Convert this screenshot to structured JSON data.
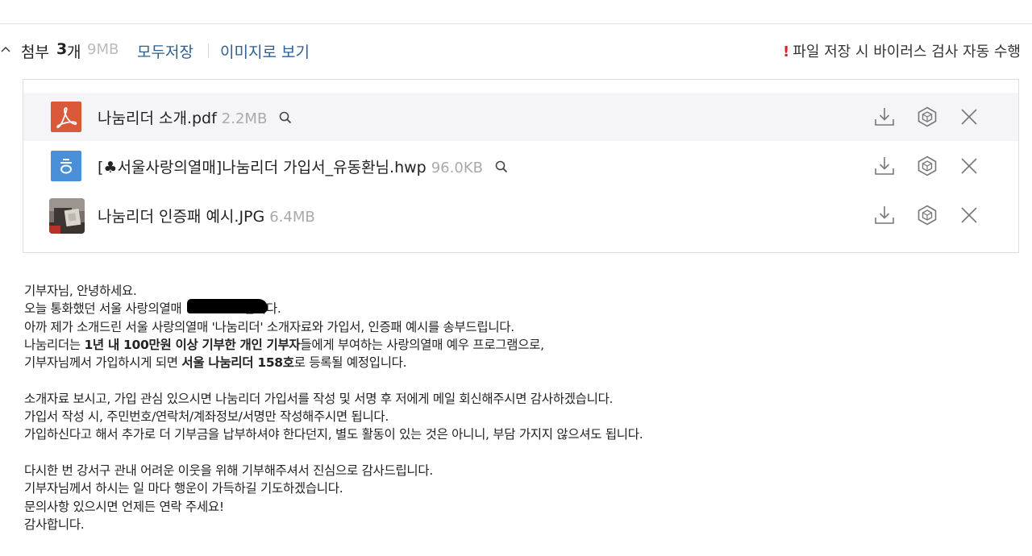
{
  "attachments": {
    "label": "첨부",
    "count": "3",
    "count_unit": "개",
    "total_size": "9MB",
    "save_all_label": "모두저장",
    "view_as_images_label": "이미지로 보기",
    "virus_notice_mark": "!",
    "virus_notice": "파일 저장 시 바이러스 검사 자동 수행",
    "files": [
      {
        "name": "나눔리더 소개.pdf",
        "size": "2.2MB",
        "type_icon": "pdf-icon"
      },
      {
        "name": "[♣서울사랑의열매]나눔리더 가입서_유동환님.hwp",
        "size": "96.0KB",
        "type_icon": "hwp-icon",
        "icon_letter": "ㅎ"
      },
      {
        "name": "나눔리더 인증패 예시.JPG",
        "size": "6.4MB",
        "type_icon": "image-thumbnail"
      }
    ]
  },
  "message": {
    "greeting": "기부자님, 안녕하세요.",
    "line2_a": "오늘 통화했던 서울 사랑의열매 ",
    "line2_b": "입니다.",
    "line3": "아까 제가 소개드린 서울 사랑의열매 '나눔리더' 소개자료와 가입서, 인증패 예시를 송부드립니다.",
    "line4_a": "나눔리더는 ",
    "line4_bold": "1년 내 100만원 이상 기부한 개인 기부자",
    "line4_b": "들에게 부여하는 사랑의열매 예우 프로그램으로,",
    "line5_a": "기부자님께서 가입하시게 되면 ",
    "line5_bold": "서울 나눔리더 158호",
    "line5_b": "로 등록될 예정입니다.",
    "line6": "소개자료 보시고, 가입 관심 있으시면 나눔리더 가입서를 작성 및 서명 후 저에게 메일 회신해주시면 감사하겠습니다.",
    "line7": "가입서 작성 시, 주민번호/연락처/계좌정보/서명만 작성해주시면 됩니다.",
    "line8": "가입하신다고 해서 추가로 더 기부금을 납부하셔야 한다던지, 별도 활동이 있는 것은 아니니, 부담 가지지 않으셔도 됩니다.",
    "line9": "다시한 번 강서구 관내 어려운 이웃을 위해 기부해주셔서 진심으로 감사드립니다.",
    "line10": "기부자님께서 하시는 일 마다 행운이 가득하길 기도하겠습니다.",
    "line11": "문의사항 있으시면 언제든 연락 주세요!",
    "closing": "감사합니다."
  },
  "colors": {
    "link": "#2d5f93",
    "pdf_icon": "#d9593a",
    "hwp_icon": "#4a90d9",
    "notice_mark": "#e02020",
    "muted_size": "#aaaaaa"
  }
}
